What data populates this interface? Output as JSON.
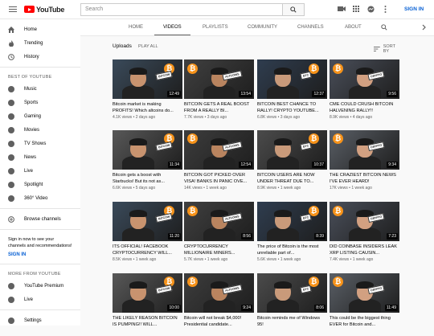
{
  "topbar": {
    "logo_text": "YouTube",
    "search_placeholder": "Search",
    "signin_label": "SIGN IN"
  },
  "sidebar": {
    "main": [
      {
        "label": "Home",
        "icon": "home-icon"
      },
      {
        "label": "Trending",
        "icon": "fire-icon"
      },
      {
        "label": "History",
        "icon": "history-icon"
      }
    ],
    "best_heading": "BEST OF YOUTUBE",
    "best": [
      {
        "label": "Music",
        "icon": "music-icon"
      },
      {
        "label": "Sports",
        "icon": "sports-icon"
      },
      {
        "label": "Gaming",
        "icon": "gaming-icon"
      },
      {
        "label": "Movies",
        "icon": "movies-icon"
      },
      {
        "label": "TV Shows",
        "icon": "tv-icon"
      },
      {
        "label": "News",
        "icon": "news-icon"
      },
      {
        "label": "Live",
        "icon": "live-icon"
      },
      {
        "label": "Spotlight",
        "icon": "spotlight-icon"
      },
      {
        "label": "360° Video",
        "icon": "video-360-icon"
      }
    ],
    "browse_channels": "Browse channels",
    "signin_prompt": "Sign in now to see your channels and recommendations!",
    "signin_label": "SIGN IN",
    "more_heading": "MORE FROM YOUTUBE",
    "more": [
      {
        "label": "YouTube Premium",
        "icon": "premium-icon"
      },
      {
        "label": "Live",
        "icon": "live-icon"
      }
    ],
    "settings_label": "Settings"
  },
  "tabs": [
    "HOME",
    "VIDEOS",
    "PLAYLISTS",
    "COMMUNITY",
    "CHANNELS",
    "ABOUT"
  ],
  "active_tab": "VIDEOS",
  "uploads": {
    "title": "Uploads",
    "play_all": "PLAY ALL",
    "sort_by": "SORT BY"
  },
  "videos": [
    {
      "title": "Bitcoin market is making PROFITS! Which altcoins do...",
      "views": "4.1K views",
      "age": "2 days ago",
      "duration": "12:49"
    },
    {
      "title": "BITCOIN GETS A REAL BOOST FROM A REALLY BI...",
      "views": "7.7K views",
      "age": "3 days ago",
      "duration": "13:54"
    },
    {
      "title": "BITCOIN BEST CHANCE TO RALLY! CRYPTO YOUTUBE...",
      "views": "6.8K views",
      "age": "3 days ago",
      "duration": "12:37"
    },
    {
      "title": "CME COULD CRUSH BITCOIN HALVENING RALLY!!",
      "views": "8.9K views",
      "age": "4 days ago",
      "duration": "9:56"
    },
    {
      "title": "Bitcoin gets a boost with Starbucks! But its not as...",
      "views": "6.6K views",
      "age": "5 days ago",
      "duration": "11:34"
    },
    {
      "title": "BITCOIN GOT PICKED OVER VISA! BANKS IN PANIC OVE...",
      "views": "14K views",
      "age": "1 week ago",
      "duration": "12:54"
    },
    {
      "title": "BITCOIN USERS ARE NOW UNDER THREAT DUE TO...",
      "views": "8.9K views",
      "age": "1 week ago",
      "duration": "10:37"
    },
    {
      "title": "THE CRAZIEST BITCOIN NEWS I'VE EVER HEARD!",
      "views": "17K views",
      "age": "1 week ago",
      "duration": "9:34"
    },
    {
      "title": "ITS OFFICIAL! FACEBOOK CRYPTOCURRENCY WILL...",
      "views": "8.5K views",
      "age": "1 week ago",
      "duration": "11:20"
    },
    {
      "title": "CRYPTOCURRENCY MILLIONAIRE MINERS...",
      "views": "5.7K views",
      "age": "1 week ago",
      "duration": "8:56"
    },
    {
      "title": "The price of Bitcoin is the most unreliable part of...",
      "views": "5.6K views",
      "age": "1 week ago",
      "duration": "8:39"
    },
    {
      "title": "DID COINBASE INSIDERS LEAK XRP LISTING CAUSIN...",
      "views": "7.4K views",
      "age": "1 week ago",
      "duration": "7:23"
    },
    {
      "title": "THE LIKELY REASON BITCOIN IS PUMPING!! WILL...",
      "views": "",
      "age": "",
      "duration": "10:00"
    },
    {
      "title": "Bitcoin will not break $4,000! Presidential candidate...",
      "views": "",
      "age": "",
      "duration": "9:24"
    },
    {
      "title": "Bitcoin reminds me of Windows 95!",
      "views": "",
      "age": "",
      "duration": "8:06"
    },
    {
      "title": "This could be the biggest thing EVER for Bitcoin and...",
      "views": "",
      "age": "",
      "duration": "11:49"
    }
  ],
  "colors": {
    "brand_red": "#ff0000",
    "link_blue": "#065fd4",
    "bitcoin_orange": "#f7931a"
  }
}
